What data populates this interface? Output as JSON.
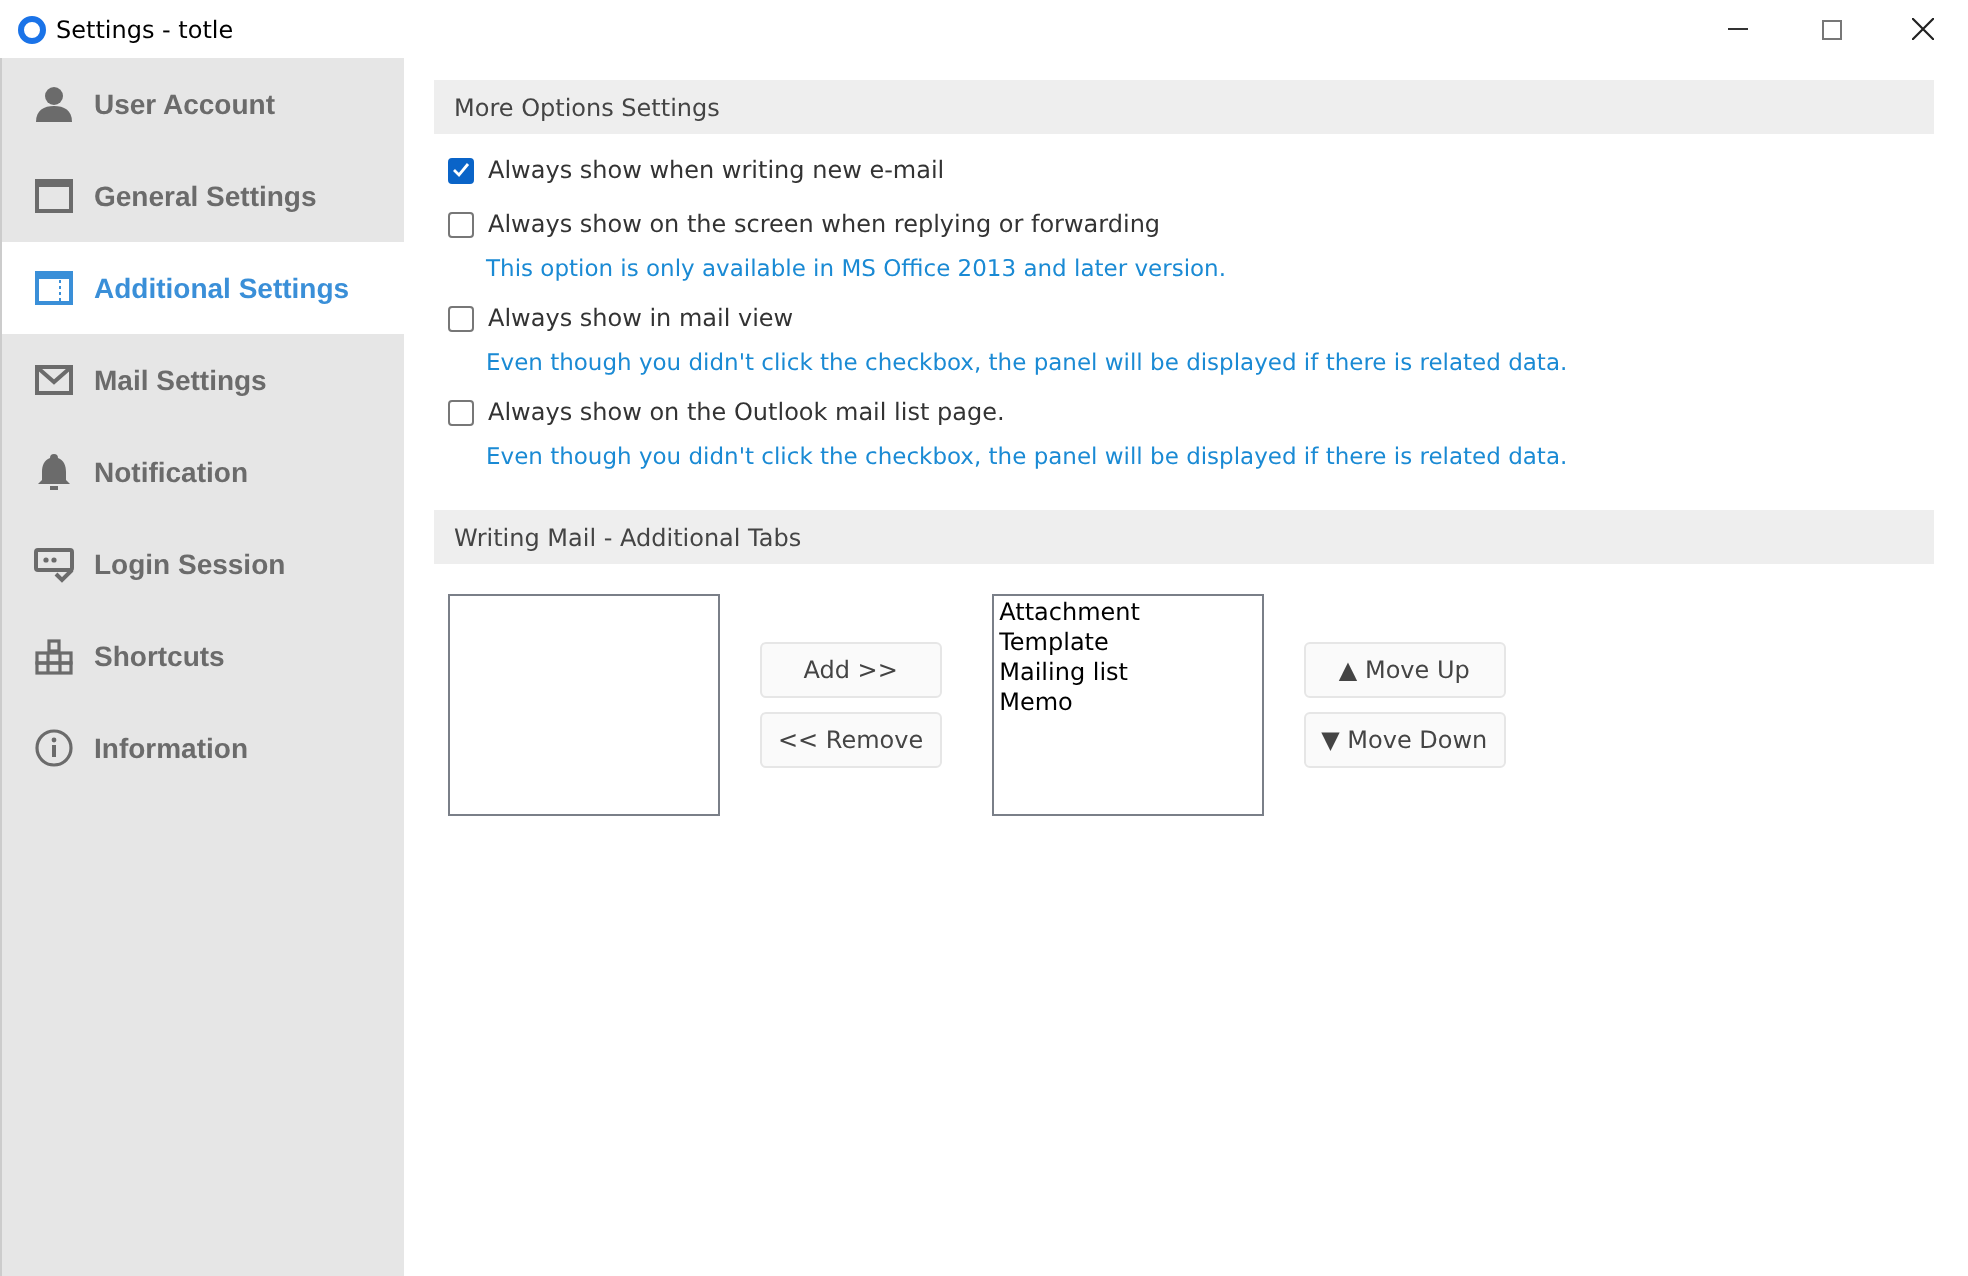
{
  "window": {
    "title": "Settings - totle"
  },
  "sidebar": {
    "items": [
      {
        "label": "User Account",
        "selected": false
      },
      {
        "label": "General Settings",
        "selected": false
      },
      {
        "label": "Additional Settings",
        "selected": true
      },
      {
        "label": "Mail Settings",
        "selected": false
      },
      {
        "label": "Notification",
        "selected": false
      },
      {
        "label": "Login Session",
        "selected": false
      },
      {
        "label": "Shortcuts",
        "selected": false
      },
      {
        "label": "Information",
        "selected": false
      }
    ]
  },
  "more_options": {
    "title": "More Options Settings",
    "options": [
      {
        "label": "Always show when writing new e-mail",
        "checked": true
      },
      {
        "label": "Always show on the screen when replying or forwarding",
        "checked": false,
        "note": "This option is only available in MS Office 2013 and later version."
      },
      {
        "label": "Always show in mail view",
        "checked": false,
        "note": "Even though you didn't click the checkbox, the panel will be displayed if there is related data."
      },
      {
        "label": "Always show on the Outlook mail list page.",
        "checked": false,
        "note": "Even though you didn't click the checkbox, the panel will be displayed if there is related data."
      }
    ]
  },
  "additional_tabs": {
    "title": "Writing Mail - Additional Tabs",
    "add_button": "Add >>",
    "remove_button": "<< Remove",
    "selected_tabs": [
      "Attachment",
      "Template",
      "Mailing list",
      "Memo"
    ],
    "move_up_button": "▲ Move Up",
    "move_down_button": "▼ Move Down"
  }
}
